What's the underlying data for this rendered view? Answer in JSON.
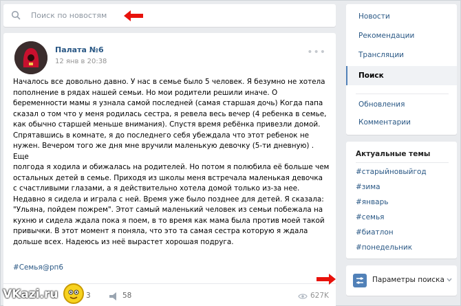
{
  "search": {
    "placeholder": "Поиск по новостям"
  },
  "post": {
    "author": "Палата №6",
    "date": "12 янв в 20:38",
    "text": "Началось все довольно давно. У нас в семье было 5 человек. Я безумно не хотела\nпополнение в рядах нашей семьи. Но мои родители решили иначе. О\nберемeнности мамы я узнала самой последней (самая старшая дочь) Когда папа\nсказал о том что у меня родилась сестра, я ревела весь вечер (4 ребенка в семье,\nкак обычно старшей меньше внимания). Спустя время ребёнка привезли домой.\nСпрятавшись в комнате, я до последнего себя убеждала что этот ребенок не\nнужен. Вечером того же дня мне вручили маленькую девочку (5-ти дневную) . Еще\nполгода я ходила и обижалась на родителей. Но потом я полюбила её больше чем\nостальных детей в семье. Приходя из школы меня встречала маленькая девочка\nс счастливыми глазами, а я действительно хотела домой только из-за нее.\nНедавно я сидела и играла с ней. Время уже было позднее для детей. Я сказала:\n\"Ульяна, пойдем пожрем\". Этот самый маленький человек из семьи побежала на\nкухню и сидела ждала пока я поем, в то время как мама была против моей такой\nпривычки. В этот момент я поняла, что это та самая сестра которую я ждала\nдольше всех. Надеюсь из неё вырастет хорошая подруга.",
    "hashtag": "#Семья@рп6",
    "comments": "3",
    "shares": "58",
    "views": "627K"
  },
  "menu": {
    "items": [
      {
        "label": "Новости",
        "active": false
      },
      {
        "label": "Рекомендации",
        "active": false
      },
      {
        "label": "Трансляции",
        "active": false
      },
      {
        "label": "Поиск",
        "active": true
      },
      {
        "label": "Обновления",
        "active": false
      },
      {
        "label": "Комментарии",
        "active": false
      }
    ]
  },
  "topics": {
    "title": "Актуальные темы",
    "items": [
      "#старыйновыйгод",
      "#зима",
      "#январь",
      "#семья",
      "#биатлон",
      "#понедельник"
    ]
  },
  "params": {
    "label": "Параметры поиска"
  },
  "watermark": {
    "text": "VKazi.ru"
  },
  "colors": {
    "link": "#2a5885",
    "accent": "#5181b8",
    "annotation_arrow": "#e8120c",
    "background": "#e9ebee"
  }
}
